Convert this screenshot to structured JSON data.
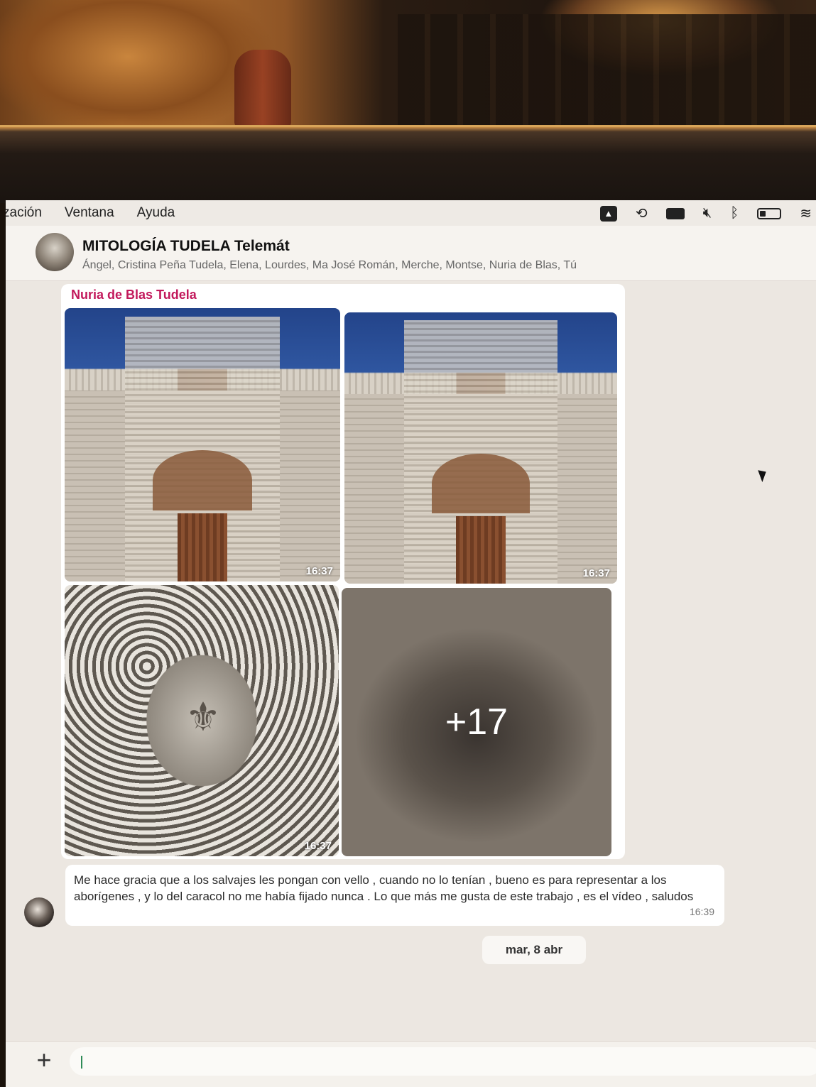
{
  "menubar": {
    "items": [
      "zación",
      "Ventana",
      "Ayuda"
    ]
  },
  "status_icons": [
    "drive-icon",
    "time-machine-icon",
    "keyboard-icon",
    "mute-icon",
    "bluetooth-icon",
    "battery-icon",
    "wifi-icon"
  ],
  "chat": {
    "title": "MITOLOGÍA TUDELA Telemát",
    "members": "Ángel, Cristina Peña Tudela, Elena, Lourdes, Ma José Román, Merche, Montse, Nuria de Blas, Tú"
  },
  "media_message": {
    "sender": "Nuria de Blas Tudela",
    "photos": [
      {
        "time": "16:37"
      },
      {
        "time": "16:37"
      },
      {
        "time": "16:37"
      },
      {
        "more": "+17"
      }
    ]
  },
  "text_message": {
    "text": "Me hace gracia que a los salvajes les pongan con vello , cuando no lo tenían , bueno es para representar a los aborígenes , y lo del caracol no me había fijado nunca . Lo que más me gusta de este trabajo , es el vídeo , saludos",
    "time": "16:39"
  },
  "date_divider": "mar, 8 abr",
  "composer": {
    "add_label": "+",
    "placeholder": ""
  }
}
